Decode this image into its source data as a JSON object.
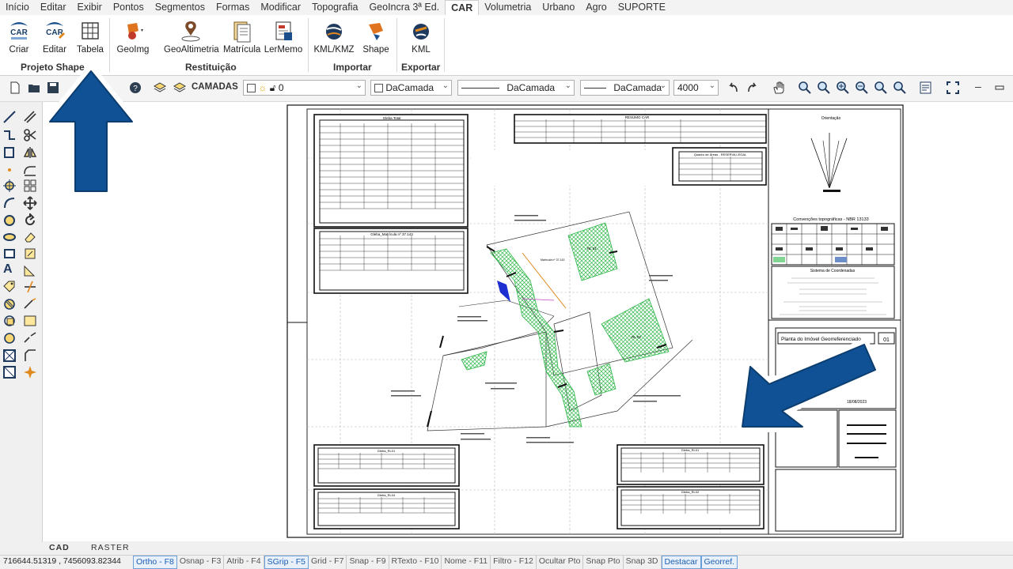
{
  "menubar": {
    "items": [
      "Início",
      "Editar",
      "Exibir",
      "Pontos",
      "Segmentos",
      "Formas",
      "Modificar",
      "Topografia",
      "GeoIncra 3ª Ed.",
      "CAR",
      "Volumetria",
      "Urbano",
      "Agro",
      "SUPORTE"
    ],
    "active": "CAR"
  },
  "ribbon": {
    "buttons": {
      "criar": "Criar",
      "editar": "Editar",
      "tabela": "Tabela",
      "geoimg": "GeoImg",
      "geoaltimetria": "GeoAltimetria",
      "matricula": "Matrícula",
      "lermemo": "LerMemo",
      "kmlkmz": "KML/KMZ",
      "shape": "Shape",
      "kml": "KML"
    },
    "groups": {
      "projeto": "Projeto Shape",
      "restituicao": "Restituição",
      "importar": "Importar",
      "exportar": "Exportar"
    },
    "icon_texts": {
      "car1": "CAR",
      "car2": "CAR"
    }
  },
  "toolbar": {
    "camadas": "CAMADAS",
    "layer": "0",
    "color": "DaCamada",
    "linetype": "DaCamada",
    "lineweight": "DaCamada",
    "scale": "4000"
  },
  "status": {
    "tabs": {
      "cad": "CAD",
      "raster": "RASTER"
    },
    "coords": "716644.51319 , 7456093.82344",
    "items": [
      {
        "label": "Ortho - F8",
        "on": true
      },
      {
        "label": "Osnap - F3",
        "on": false
      },
      {
        "label": "Atrib - F4",
        "on": false
      },
      {
        "label": "SGrip - F5",
        "on": true
      },
      {
        "label": "Grid - F7",
        "on": false
      },
      {
        "label": "Snap - F9",
        "on": false
      },
      {
        "label": "RTexto - F10",
        "on": false
      },
      {
        "label": "Nome - F11",
        "on": false
      },
      {
        "label": "Filtro - F12",
        "on": false
      },
      {
        "label": "Ocultar Pto",
        "on": false
      },
      {
        "label": "Snap Pto",
        "on": false
      },
      {
        "label": "Snap 3D",
        "on": false
      },
      {
        "label": "Destacar",
        "on": true
      },
      {
        "label": "Georref.",
        "on": true
      }
    ]
  },
  "drawing": {
    "table_titles": {
      "t1": "Gleba Total",
      "t2": "Gleba_Matrícula nº 37.143",
      "t3": "Gleba_RL01",
      "t4": "Gleba_RL04",
      "t5": "Gleba_RL01",
      "t6": "Gleba_RL02",
      "resumo": "RESUMO CAR",
      "quadro": "Quadro de Áreas - RESERVA LEGAL"
    },
    "notes": {
      "orientacao": "Orientação",
      "convencoes": "Convenções topográficas - NBR 13133",
      "sistema": "Sistema de Coordenadas",
      "planta": "Planta do Imóvel Georreferenciado",
      "folha": "01",
      "rl01": "RL 01",
      "rl02": "RL 02",
      "matricula": "Matrícula nº 37.143",
      "data": "18/08/2023"
    }
  },
  "colors": {
    "accent_blue": "#1a4f8b",
    "arrow_blue": "#0f5194",
    "hatch_green": "#2fb84a"
  }
}
